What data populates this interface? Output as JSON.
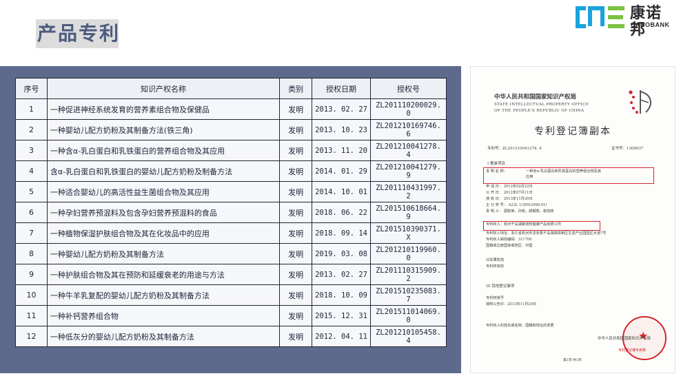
{
  "page": {
    "title": "产品专利"
  },
  "logo": {
    "mark": "CNE",
    "name_cn": "康诺邦",
    "name_en": "CANOBANK",
    "brand_color": "#1aa3dc",
    "accent_color": "#7cc242"
  },
  "colors": {
    "panel": "#5e6a8c",
    "title_text": "#4d5b7e",
    "stamp_red": "#d4232a"
  },
  "table": {
    "headers": [
      "序号",
      "知识产权名称",
      "类别",
      "授权日期",
      "授权号"
    ],
    "rows": [
      [
        "1",
        "一种促进神经系统发育的营养素组合物及保健品",
        "发明",
        "2013. 02. 27",
        "ZL201110200029. 0"
      ],
      [
        "2",
        "一种婴幼儿配方奶粉及其制备方法(铁三角)",
        "发明",
        "2013. 10. 23",
        "ZL201210169746. 6"
      ],
      [
        "3",
        "一种含α-乳白蛋白和乳铁蛋白的营养组合物及其应用",
        "发明",
        "2013. 11. 20",
        "ZL201210041278. 4"
      ],
      [
        "4",
        "含α-乳白蛋白和乳铁蛋白的婴幼儿配方奶粉及制备方法",
        "发明",
        "2014. 01. 29",
        "ZL201210041279. 9"
      ],
      [
        "5",
        "一种适合婴幼儿的高活性益生菌组合物及其应用",
        "发明",
        "2014. 10. 01",
        "ZL201110431997. 2"
      ],
      [
        "6",
        "一种孕妇营养预混料及包含孕妇营养预混料的食品",
        "发明",
        "2018. 06. 22",
        "ZL201510618664. 9"
      ],
      [
        "7",
        "一种植物保湿护肤组合物及其在化妆品中的应用",
        "发明",
        "2018. 09. 14",
        "ZL201510390371. X"
      ],
      [
        "8",
        "一种婴幼儿配方奶粉及其制备方法",
        "发明",
        "2019. 03. 08",
        "ZL201210119960. 0"
      ],
      [
        "9",
        "一种护肤组合物及其在预防和延缓衰老的用途与方法",
        "发明",
        "2013. 02. 27",
        "ZL201110315909. 2"
      ],
      [
        "10",
        "一种牛羊乳复配的婴幼儿配方奶粉及其制备方法",
        "发明",
        "2018. 10. 09",
        "ZL201510235083. 7"
      ],
      [
        "11",
        "一种补钙营养组合物",
        "发明",
        "2015. 12. 31",
        "ZL201511014069. 0"
      ],
      [
        "12",
        "一种低灰分的婴幼儿配方奶粉及其制备方法",
        "发明",
        "2012. 04. 11",
        "ZL201210105458. 4"
      ]
    ]
  },
  "certificate": {
    "office_cn": "中华人民共和国国家知识产权局",
    "office_en_1": "STATE INTELLECTUAL PROPERTY OFFICE",
    "office_en_2": "OF THE PEOPLE'S REPUBLIC OF CHINA",
    "doc_title": "专利登记簿副本",
    "patent_no": "专利号：ZL201210041278. 4",
    "cert_no": "证书号：1309937",
    "section1": "I 著录项目",
    "invention_label": "发  明  名  称：",
    "invention_name_1": "一种含α-乳白蛋白和乳铁蛋白的营养组合物及其",
    "invention_name_2": "应用",
    "apply_date": "申    请    日：  2012年02月22日",
    "publish_date": "公    开    日：  2012年07月11日",
    "grant_date": "授    权    日：  2013年11月20日",
    "ipc": "主  分  类  号：  A23L 1/305(2006.01)",
    "inventors": "发    明    人：  邵胜荣，孙俊，胡钢亮，谢自妹",
    "owner": "专利权人：杭州千岛湖康诺邦健康产品有限公司",
    "address": "专利权人地址：浙江省杭州市淳安县千岛湖高铁新区生态产业园园区大道7号",
    "postcode": "专利权人邮政编码：311700",
    "region": "国籍或注册国家或地区：中国",
    "section2": "II法律状态",
    "status": "专利权有效",
    "section3": "III  其他登记事项",
    "grant_title": "专利权授予",
    "grant_text": "授权公告日：2013年11月20日",
    "changes": "专利权人的姓名或名称、国籍和地址的变更",
    "footer_issuer": "中华人民共和国国家知识产权局",
    "page_info": "第1页    共3页",
    "stamp_text": "专利登记簿专用章"
  }
}
